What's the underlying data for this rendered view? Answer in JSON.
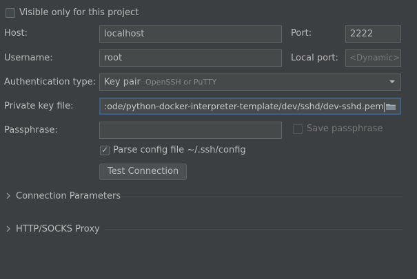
{
  "visibility": {
    "checkbox_label": "Visible only for this project",
    "checked": false
  },
  "host": {
    "label": "Host:",
    "value": "localhost"
  },
  "port": {
    "label": "Port:",
    "value": "2222"
  },
  "username": {
    "label": "Username:",
    "value": "root"
  },
  "local_port": {
    "label": "Local port:",
    "placeholder": "<Dynamic>"
  },
  "auth_type": {
    "label": "Authentication type:",
    "selected": "Key pair",
    "selected_hint": "OpenSSH or PuTTY"
  },
  "private_key": {
    "label": "Private key file:",
    "value": ":ode/python-docker-interpreter-template/dev/sshd/dev-sshd.pem"
  },
  "passphrase": {
    "label": "Passphrase:",
    "value": "",
    "save_label": "Save passphrase",
    "save_checked": false
  },
  "config_file": {
    "label": "Parse config file ~/.ssh/config",
    "checked": true
  },
  "test_connection": {
    "label": "Test Connection"
  },
  "sections": {
    "connection_parameters": "Connection Parameters",
    "http_socks_proxy": "HTTP/SOCKS Proxy"
  },
  "icons": {
    "folder": "folder-icon",
    "dropdown": "chevron-down-icon",
    "expand": "chevron-right-icon"
  },
  "colors": {
    "background": "#3c3f41",
    "field_background": "#45494a",
    "focus_border": "#3d6185",
    "text": "#bbbbbb"
  }
}
